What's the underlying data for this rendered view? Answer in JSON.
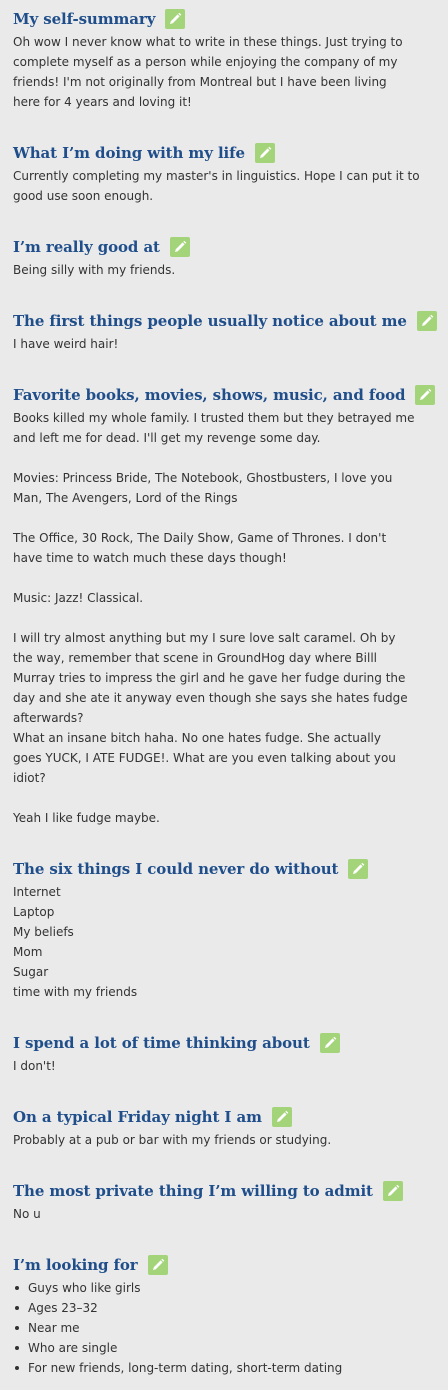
{
  "sections": [
    {
      "title": "My self-summary",
      "paragraphs": [
        [
          "Oh wow I never know what to write in these things. Just trying to",
          "complete myself as a person while enjoying the company of my",
          "friends! I'm not originally from Montreal but I have been living",
          "here for 4 years and loving it!"
        ]
      ]
    },
    {
      "title": "What I’m doing with my life",
      "paragraphs": [
        [
          "Currently completing my master's in linguistics. Hope I can put it to",
          "good use soon enough."
        ]
      ]
    },
    {
      "title": "I’m really good at",
      "paragraphs": [
        [
          "Being silly with my friends."
        ]
      ]
    },
    {
      "title": "The first things people usually notice about me",
      "paragraphs": [
        [
          "I have weird hair!"
        ]
      ]
    },
    {
      "title": "Favorite books, movies, shows, music, and food",
      "paragraphs": [
        [
          "Books killed my whole family. I trusted them but they betrayed me",
          "and left me for dead. I'll get my revenge some day."
        ],
        [
          "Movies: Princess Bride, The Notebook, Ghostbusters, I love you",
          "Man, The Avengers, Lord of the Rings"
        ],
        [
          "The Office, 30 Rock, The Daily Show, Game of Thrones. I don't",
          "have time to watch much these days though!"
        ],
        [
          "Music: Jazz! Classical."
        ],
        [
          "I will try almost anything but my I sure love salt caramel. Oh by",
          "the way, remember that scene in GroundHog day where Billl",
          "Murray tries to impress the girl and he gave her fudge during the",
          "day and she ate it anyway even though she says she hates fudge",
          "afterwards?",
          "What an insane bitch haha. No one hates fudge. She actually",
          "goes YUCK, I ATE FUDGE!. What are you even talking about you",
          "idiot?"
        ],
        [
          "Yeah I like fudge maybe."
        ]
      ]
    },
    {
      "title": "The six things I could never do without",
      "paragraphs": [
        [
          "Internet",
          "Laptop",
          "My beliefs",
          "Mom",
          "Sugar",
          "time with my friends"
        ]
      ]
    },
    {
      "title": "I spend a lot of time thinking about",
      "paragraphs": [
        [
          "I don't!"
        ]
      ]
    },
    {
      "title": "On a typical Friday night I am",
      "paragraphs": [
        [
          "Probably at a pub or bar with my friends or studying."
        ]
      ]
    },
    {
      "title": "The most private thing I’m willing to admit",
      "paragraphs": [
        [
          "No u"
        ]
      ]
    },
    {
      "title": "I’m looking for",
      "bullets": [
        "Guys who like girls",
        "Ages 23–32",
        "Near me",
        "Who are single",
        "For new friends, long-term dating, short-term dating"
      ]
    }
  ],
  "icons": {
    "edit": "pencil-icon"
  },
  "colors": {
    "heading": "#1f4e8a",
    "edit_button": "#a3d47a",
    "background": "#eaeaea",
    "text": "#333333"
  }
}
